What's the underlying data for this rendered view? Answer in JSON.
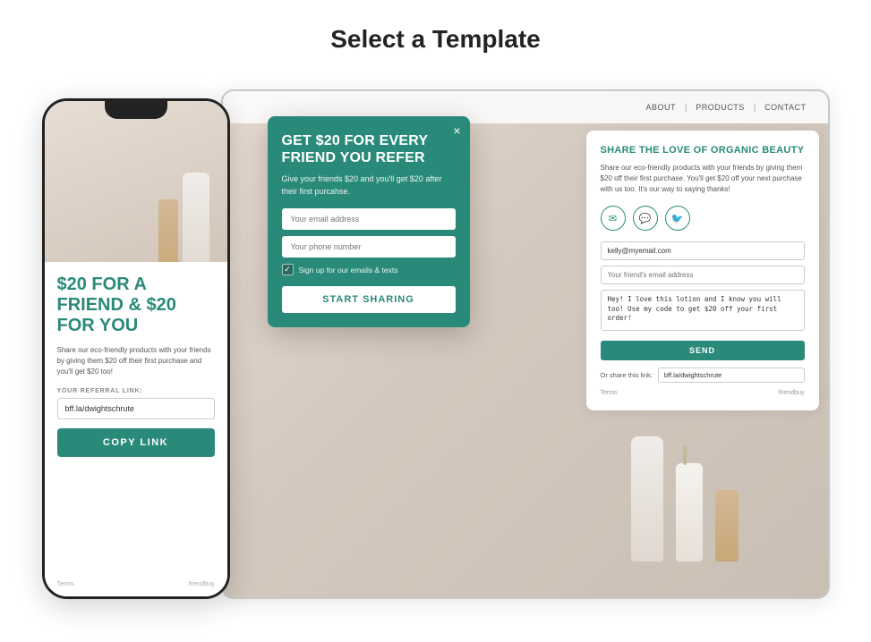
{
  "page": {
    "title": "Select a Template"
  },
  "desktop": {
    "nav": {
      "items": [
        "ABOUT",
        "|",
        "PRODUCTS",
        "|",
        "CONTACT"
      ]
    },
    "rightPanel": {
      "title": "SHARE THE LOVE OF ORGANIC BEAUTY",
      "description": "Share our eco-friendly products with your friends by giving them $20 off their first purchase. You'll get $20 off your next purchase with us too. It's our way to saying thanks!",
      "emailInputValue": "kelly@myemail.com",
      "emailInputPlaceholder": "kelly@myemail.com",
      "friendEmailPlaceholder": "Your friend's email address",
      "messageText": "Hey! I love this lotion and I know you will too! Use my code to get $20 off your first order!",
      "sendButtonLabel": "SEND",
      "shareLinkLabel": "Or share this link:",
      "shareLinkValue": "bff.la/dwightschrute",
      "footerLeft": "Terms",
      "footerRight": "friendbuy"
    },
    "popup": {
      "title": "GET $20 FOR EVERY FRIEND YOU REFER",
      "description": "Give your friends $20 and you'll get $20 after their first purcahse.",
      "emailPlaceholder": "Your email address",
      "phonePlaceholder": "Your phone number",
      "checkboxLabel": "Sign up for our emails & texts",
      "buttonLabel": "START SHARING",
      "closeIcon": "×"
    }
  },
  "mobile": {
    "headline": "$20 FOR A FRIEND & $20 FOR YOU",
    "subtext": "Share our eco-friendly products with your friends by giving them $20 off their first purchase and you'll get $20 too!",
    "referralLabel": "YOUR REFERRAL LINK:",
    "linkValue": "bff.la/dwightschrute",
    "copyButtonLabel": "COPY LINK",
    "footerLeft": "Terms",
    "footerRight": "friendbuy"
  }
}
